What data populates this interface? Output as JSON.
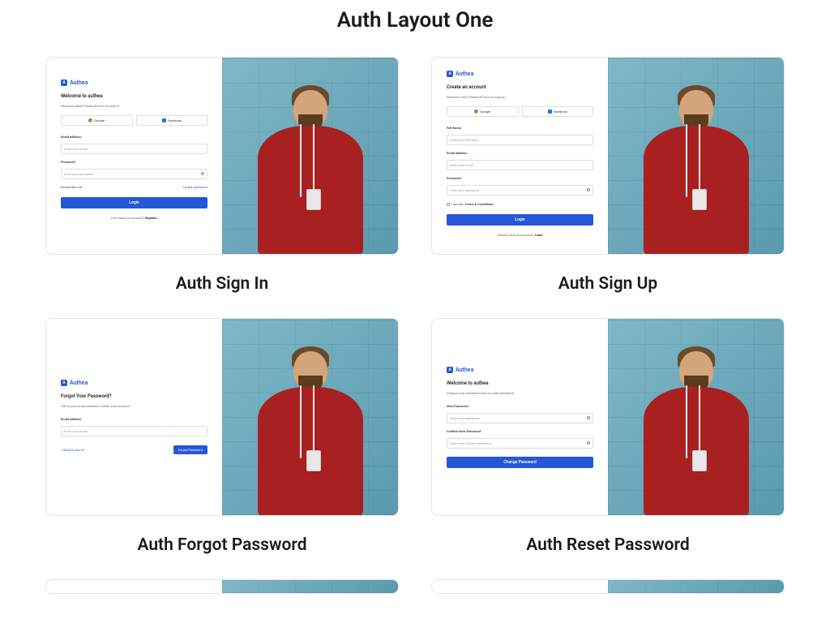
{
  "page_title": "Auth Layout One",
  "brand": "Authea",
  "cards": {
    "signin": {
      "caption": "Auth Sign In",
      "welcome": "Welcome to authea",
      "sub": "Welcome back! Please fill form to sign in",
      "google": "Google",
      "facebook": "Facebook",
      "email_label": "Email address",
      "email_ph": "Enter your email",
      "pwd_label": "Password",
      "pwd_ph": "Enter your password",
      "remember": "Remember me",
      "forgot": "Forgot password",
      "login": "Login",
      "footer_q": "Don't have an account?",
      "footer_a": "Register"
    },
    "signup": {
      "caption": "Auth Sign Up",
      "title": "Create an account",
      "sub": "Welcome here! Please fill form to sign up",
      "google": "Google",
      "facebook": "Facebook",
      "name_label": "Full Name",
      "name_ph": "Enter your full name",
      "email_label": "Email address",
      "email_ph": "Enter your email",
      "pwd_label": "Password",
      "pwd_ph": "Enter your password",
      "terms_pre": "I accept",
      "terms_link": "Terms & Conditions",
      "btn": "Login",
      "footer_q": "Already have an account?",
      "footer_a": "Login"
    },
    "forgot": {
      "caption": "Auth Forgot Password",
      "title": "Forgot Your Password?",
      "sub": "Tell us your email address to reset your account",
      "email_label": "Email address",
      "email_ph": "Enter your email",
      "back": "< Back to sign in",
      "btn": "Forgot Password"
    },
    "reset": {
      "caption": "Auth Reset Password",
      "welcome": "Welcome to authea",
      "sub": "Change your password here to make password",
      "new_label": "New Password",
      "new_ph": "Enter your password",
      "conf_label": "Confirm New Password",
      "conf_ph": "Enter your confirm password",
      "btn": "Change Password"
    }
  }
}
